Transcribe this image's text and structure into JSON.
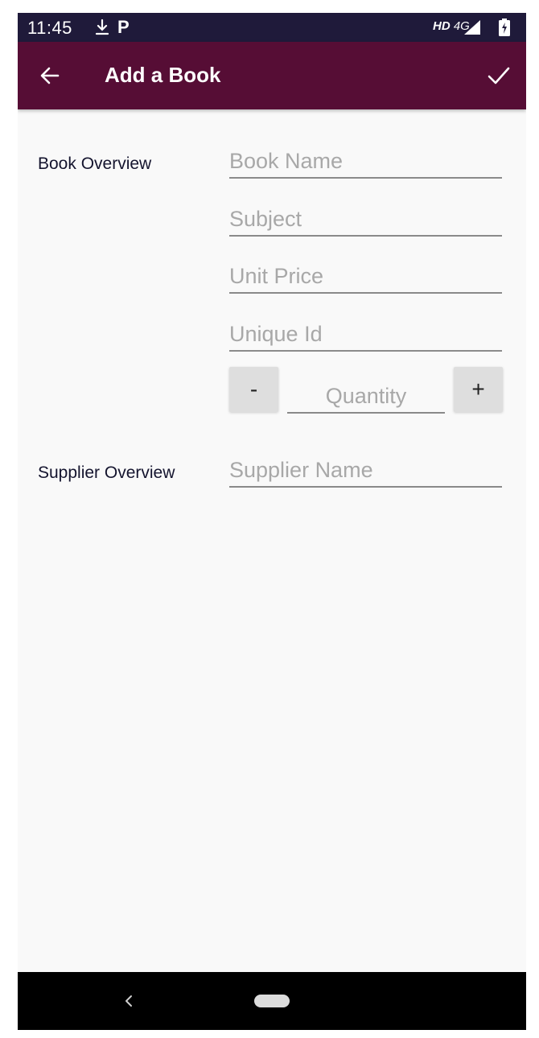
{
  "status_bar": {
    "time": "11:45",
    "network_hd": "HD",
    "network_type": "4G",
    "icons": [
      "download-icon",
      "p-notification-icon",
      "signal-icon",
      "battery-icon"
    ]
  },
  "app_bar": {
    "title": "Add a Book",
    "color": "#560d35",
    "icons": [
      "back-arrow-icon",
      "checkmark-icon"
    ]
  },
  "form": {
    "book_overview": {
      "label": "Book Overview",
      "fields": {
        "book_name": {
          "placeholder": "Book Name",
          "value": ""
        },
        "subject": {
          "placeholder": "Subject",
          "value": ""
        },
        "unit_price": {
          "placeholder": "Unit Price",
          "value": ""
        },
        "unique_id": {
          "placeholder": "Unique Id",
          "value": ""
        }
      },
      "quantity": {
        "decrement_label": "-",
        "placeholder": "Quantity",
        "value": "",
        "increment_label": "+"
      }
    },
    "supplier_overview": {
      "label": "Supplier Overview",
      "fields": {
        "supplier_name": {
          "placeholder": "Supplier Name",
          "value": ""
        }
      }
    }
  },
  "nav_bar": {
    "icons": [
      "nav-back-icon",
      "nav-home-pill-icon"
    ]
  }
}
